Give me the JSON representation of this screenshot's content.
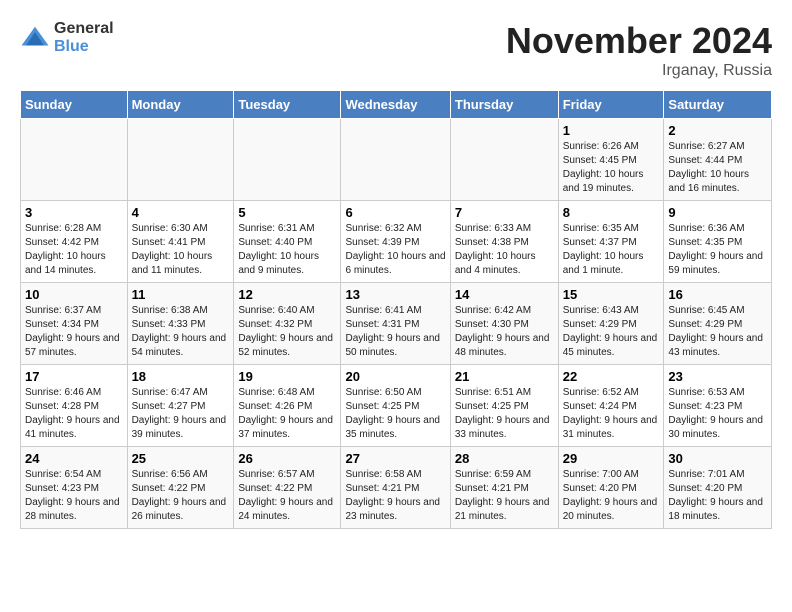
{
  "logo": {
    "general": "General",
    "blue": "Blue"
  },
  "title": "November 2024",
  "location": "Irganay, Russia",
  "days_of_week": [
    "Sunday",
    "Monday",
    "Tuesday",
    "Wednesday",
    "Thursday",
    "Friday",
    "Saturday"
  ],
  "weeks": [
    [
      {
        "day": "",
        "info": ""
      },
      {
        "day": "",
        "info": ""
      },
      {
        "day": "",
        "info": ""
      },
      {
        "day": "",
        "info": ""
      },
      {
        "day": "",
        "info": ""
      },
      {
        "day": "1",
        "info": "Sunrise: 6:26 AM\nSunset: 4:45 PM\nDaylight: 10 hours and 19 minutes."
      },
      {
        "day": "2",
        "info": "Sunrise: 6:27 AM\nSunset: 4:44 PM\nDaylight: 10 hours and 16 minutes."
      }
    ],
    [
      {
        "day": "3",
        "info": "Sunrise: 6:28 AM\nSunset: 4:42 PM\nDaylight: 10 hours and 14 minutes."
      },
      {
        "day": "4",
        "info": "Sunrise: 6:30 AM\nSunset: 4:41 PM\nDaylight: 10 hours and 11 minutes."
      },
      {
        "day": "5",
        "info": "Sunrise: 6:31 AM\nSunset: 4:40 PM\nDaylight: 10 hours and 9 minutes."
      },
      {
        "day": "6",
        "info": "Sunrise: 6:32 AM\nSunset: 4:39 PM\nDaylight: 10 hours and 6 minutes."
      },
      {
        "day": "7",
        "info": "Sunrise: 6:33 AM\nSunset: 4:38 PM\nDaylight: 10 hours and 4 minutes."
      },
      {
        "day": "8",
        "info": "Sunrise: 6:35 AM\nSunset: 4:37 PM\nDaylight: 10 hours and 1 minute."
      },
      {
        "day": "9",
        "info": "Sunrise: 6:36 AM\nSunset: 4:35 PM\nDaylight: 9 hours and 59 minutes."
      }
    ],
    [
      {
        "day": "10",
        "info": "Sunrise: 6:37 AM\nSunset: 4:34 PM\nDaylight: 9 hours and 57 minutes."
      },
      {
        "day": "11",
        "info": "Sunrise: 6:38 AM\nSunset: 4:33 PM\nDaylight: 9 hours and 54 minutes."
      },
      {
        "day": "12",
        "info": "Sunrise: 6:40 AM\nSunset: 4:32 PM\nDaylight: 9 hours and 52 minutes."
      },
      {
        "day": "13",
        "info": "Sunrise: 6:41 AM\nSunset: 4:31 PM\nDaylight: 9 hours and 50 minutes."
      },
      {
        "day": "14",
        "info": "Sunrise: 6:42 AM\nSunset: 4:30 PM\nDaylight: 9 hours and 48 minutes."
      },
      {
        "day": "15",
        "info": "Sunrise: 6:43 AM\nSunset: 4:29 PM\nDaylight: 9 hours and 45 minutes."
      },
      {
        "day": "16",
        "info": "Sunrise: 6:45 AM\nSunset: 4:29 PM\nDaylight: 9 hours and 43 minutes."
      }
    ],
    [
      {
        "day": "17",
        "info": "Sunrise: 6:46 AM\nSunset: 4:28 PM\nDaylight: 9 hours and 41 minutes."
      },
      {
        "day": "18",
        "info": "Sunrise: 6:47 AM\nSunset: 4:27 PM\nDaylight: 9 hours and 39 minutes."
      },
      {
        "day": "19",
        "info": "Sunrise: 6:48 AM\nSunset: 4:26 PM\nDaylight: 9 hours and 37 minutes."
      },
      {
        "day": "20",
        "info": "Sunrise: 6:50 AM\nSunset: 4:25 PM\nDaylight: 9 hours and 35 minutes."
      },
      {
        "day": "21",
        "info": "Sunrise: 6:51 AM\nSunset: 4:25 PM\nDaylight: 9 hours and 33 minutes."
      },
      {
        "day": "22",
        "info": "Sunrise: 6:52 AM\nSunset: 4:24 PM\nDaylight: 9 hours and 31 minutes."
      },
      {
        "day": "23",
        "info": "Sunrise: 6:53 AM\nSunset: 4:23 PM\nDaylight: 9 hours and 30 minutes."
      }
    ],
    [
      {
        "day": "24",
        "info": "Sunrise: 6:54 AM\nSunset: 4:23 PM\nDaylight: 9 hours and 28 minutes."
      },
      {
        "day": "25",
        "info": "Sunrise: 6:56 AM\nSunset: 4:22 PM\nDaylight: 9 hours and 26 minutes."
      },
      {
        "day": "26",
        "info": "Sunrise: 6:57 AM\nSunset: 4:22 PM\nDaylight: 9 hours and 24 minutes."
      },
      {
        "day": "27",
        "info": "Sunrise: 6:58 AM\nSunset: 4:21 PM\nDaylight: 9 hours and 23 minutes."
      },
      {
        "day": "28",
        "info": "Sunrise: 6:59 AM\nSunset: 4:21 PM\nDaylight: 9 hours and 21 minutes."
      },
      {
        "day": "29",
        "info": "Sunrise: 7:00 AM\nSunset: 4:20 PM\nDaylight: 9 hours and 20 minutes."
      },
      {
        "day": "30",
        "info": "Sunrise: 7:01 AM\nSunset: 4:20 PM\nDaylight: 9 hours and 18 minutes."
      }
    ]
  ]
}
